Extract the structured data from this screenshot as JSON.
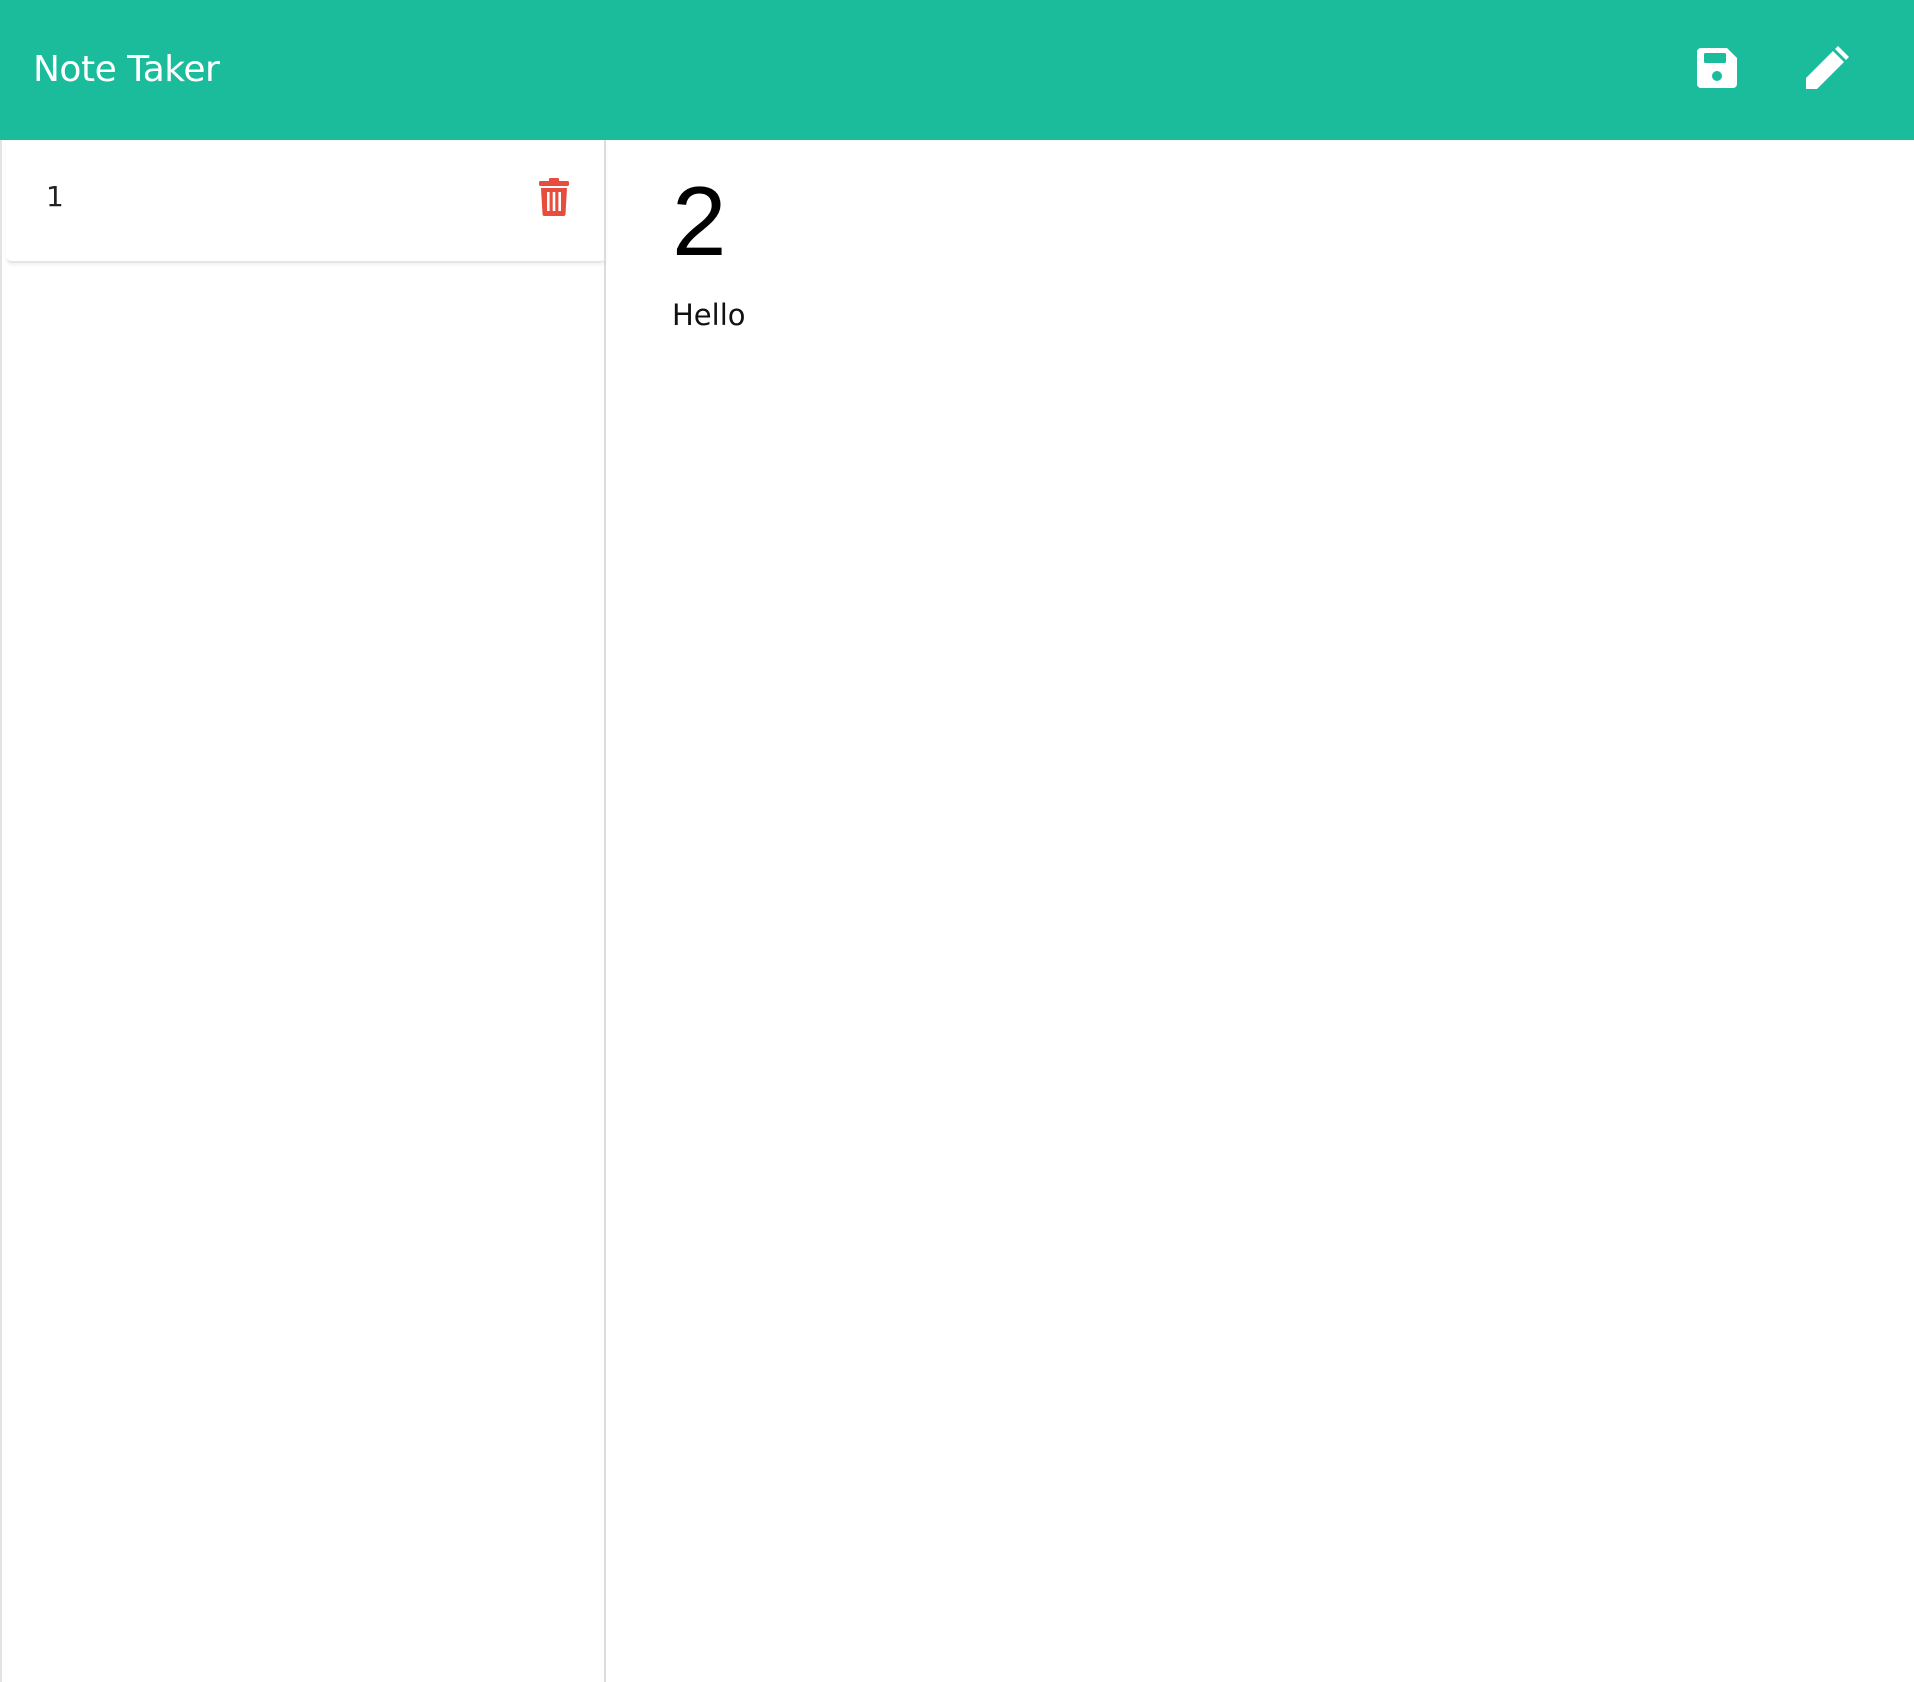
{
  "navbar": {
    "brand": "Note Taker",
    "save_icon": "save-icon",
    "write_icon": "pencil-icon",
    "background": "#1abc9c",
    "icon_color": "#ffffff"
  },
  "sidebar": {
    "notes": [
      {
        "title": "1",
        "delete_icon": "trash-icon",
        "delete_color": "#e74c3c"
      }
    ]
  },
  "main": {
    "note_title": "2",
    "note_text": "Hello"
  }
}
